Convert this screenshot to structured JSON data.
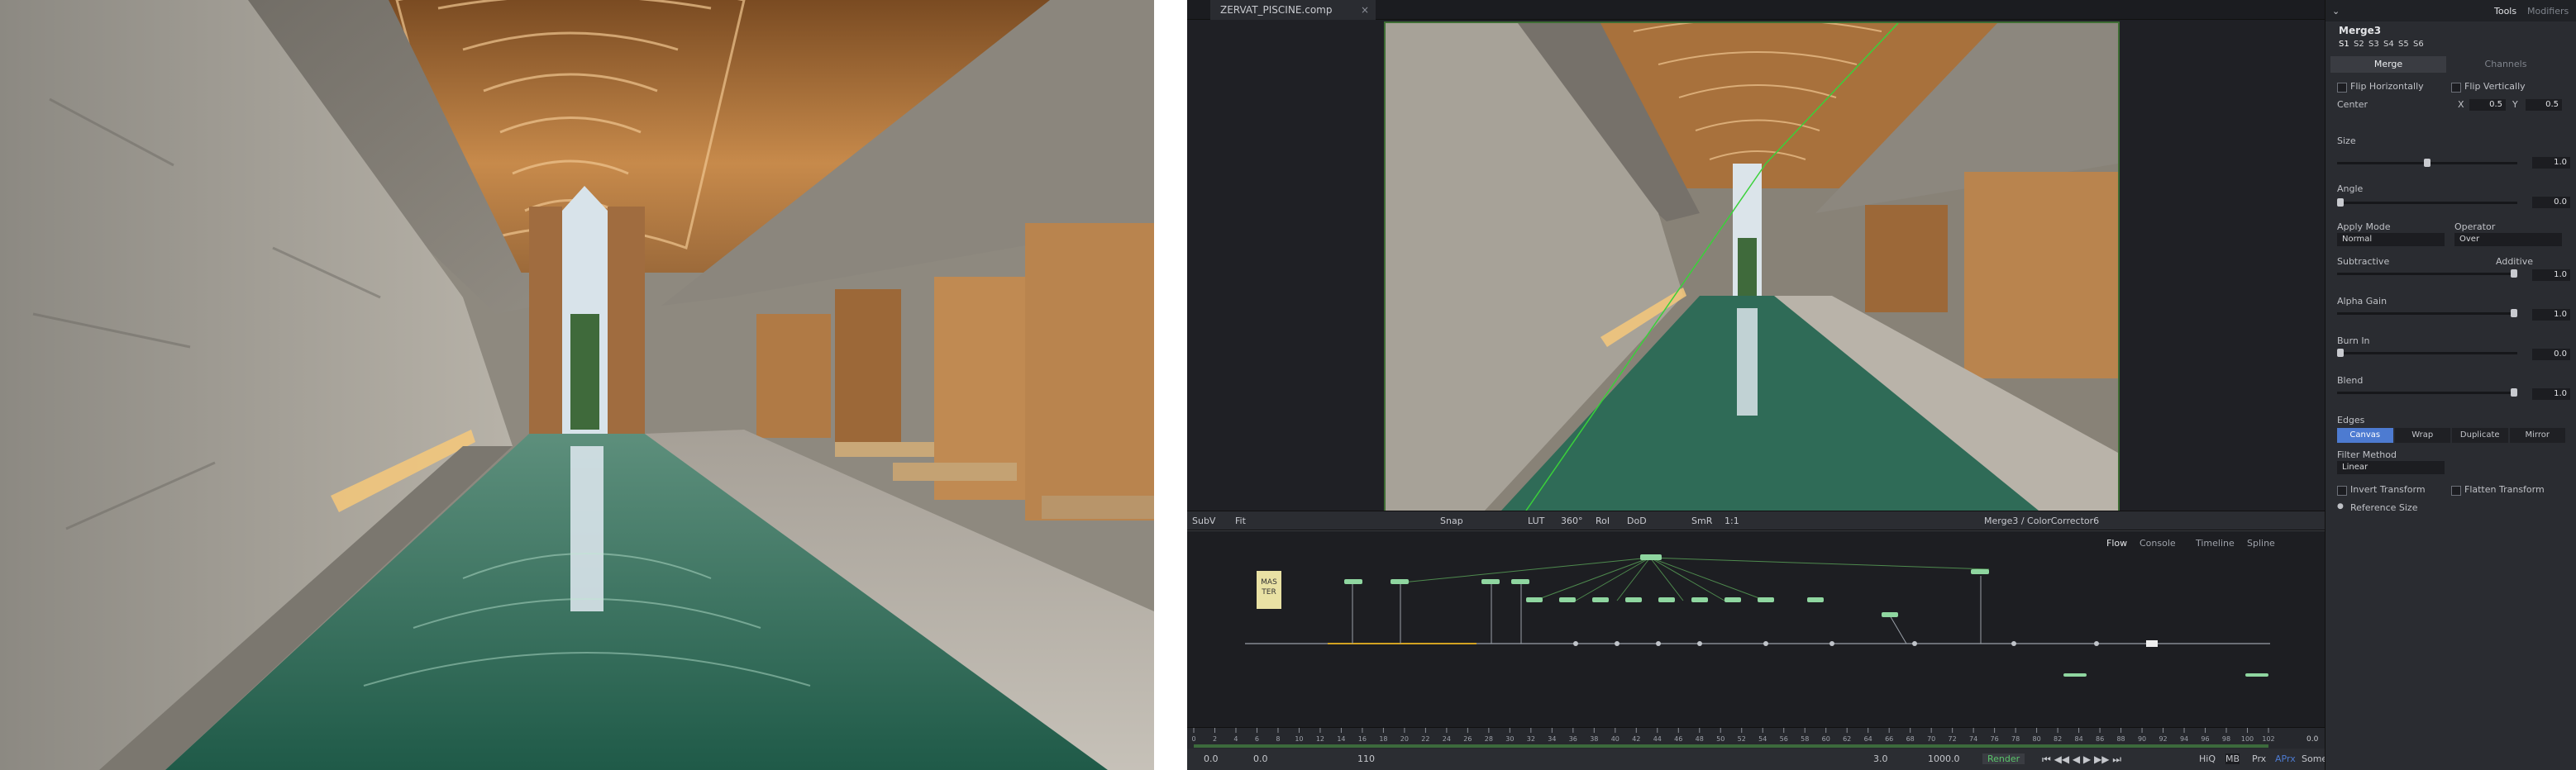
{
  "tab": {
    "name": "ZERVAT_PISCINE.comp",
    "close": "×"
  },
  "viewer_toolbar": {
    "subv": "SubV",
    "fit": "Fit",
    "snap": "Snap",
    "lut": "LUT",
    "rotation": "360°",
    "roi": "RoI",
    "dod": "DoD",
    "smr": "SmR",
    "ratio": "1:1",
    "node_path": "Merge3 / ColorCorrector6"
  },
  "flow_tabs": {
    "flow": "Flow",
    "console": "Console",
    "timeline": "Timeline",
    "spline": "Spline"
  },
  "flow_note": {
    "line1": "MAS",
    "line2": "TER"
  },
  "ruler": {
    "ticks": [
      "0",
      "2",
      "4",
      "6",
      "8",
      "10",
      "12",
      "14",
      "16",
      "18",
      "20",
      "22",
      "24",
      "26",
      "28",
      "30",
      "32",
      "34",
      "36",
      "38",
      "40",
      "42",
      "44",
      "46",
      "48",
      "50",
      "52",
      "54",
      "56",
      "58",
      "60",
      "62",
      "64",
      "66",
      "68",
      "70",
      "72",
      "74",
      "76",
      "78",
      "80",
      "82",
      "84",
      "86",
      "88",
      "90",
      "92",
      "94",
      "96",
      "98",
      "100",
      "102"
    ],
    "end_value": "0.0"
  },
  "transport": {
    "start": "0.0",
    "render_start": "0.0",
    "range": "110",
    "render_end": "3.0",
    "end": "1000.0",
    "render_button": "Render",
    "hiq": "HiQ",
    "mb": "MB",
    "prx": "Prx",
    "aprx": "APrx",
    "some": "Some"
  },
  "inspector": {
    "tabs": {
      "tools": "Tools",
      "modifiers": "Modifiers"
    },
    "node_name": "Merge3",
    "version_slots": [
      "S1",
      "S2",
      "S3",
      "S4",
      "S5",
      "S6"
    ],
    "subtabs": {
      "merge": "Merge",
      "channels": "Channels"
    },
    "flip_h": "Flip Horizontally",
    "flip_v": "Flip Vertically",
    "center": {
      "label": "Center",
      "x_label": "X",
      "x": "0.5",
      "y_label": "Y",
      "y": "0.5"
    },
    "size": {
      "label": "Size",
      "value": "1.0",
      "fraction": 0.5
    },
    "angle": {
      "label": "Angle",
      "value": "0.0",
      "fraction": 0.0
    },
    "apply_mode": {
      "label": "Apply Mode",
      "value": "Normal"
    },
    "operator": {
      "label": "Operator",
      "value": "Over"
    },
    "subtractive": "Subtractive",
    "additive": {
      "label": "Additive",
      "value": "1.0",
      "fraction": 1.0
    },
    "alpha_gain": {
      "label": "Alpha Gain",
      "value": "1.0",
      "fraction": 1.0
    },
    "burn_in": {
      "label": "Burn In",
      "value": "0.0",
      "fraction": 0.0
    },
    "blend": {
      "label": "Blend",
      "value": "1.0",
      "fraction": 1.0
    },
    "edges": {
      "label": "Edges",
      "options": [
        "Canvas",
        "Wrap",
        "Duplicate",
        "Mirror"
      ],
      "selected": "Canvas"
    },
    "filter_method": {
      "label": "Filter Method",
      "value": "Linear"
    },
    "invert_transform": "Invert Transform",
    "flatten_transform": "Flatten Transform",
    "reference_size": "Reference Size"
  },
  "colors": {
    "accent": "#4d7bd1",
    "frame": "#3e6d34",
    "node_green": "#8fd6a0",
    "render_green": "#59c46a"
  }
}
